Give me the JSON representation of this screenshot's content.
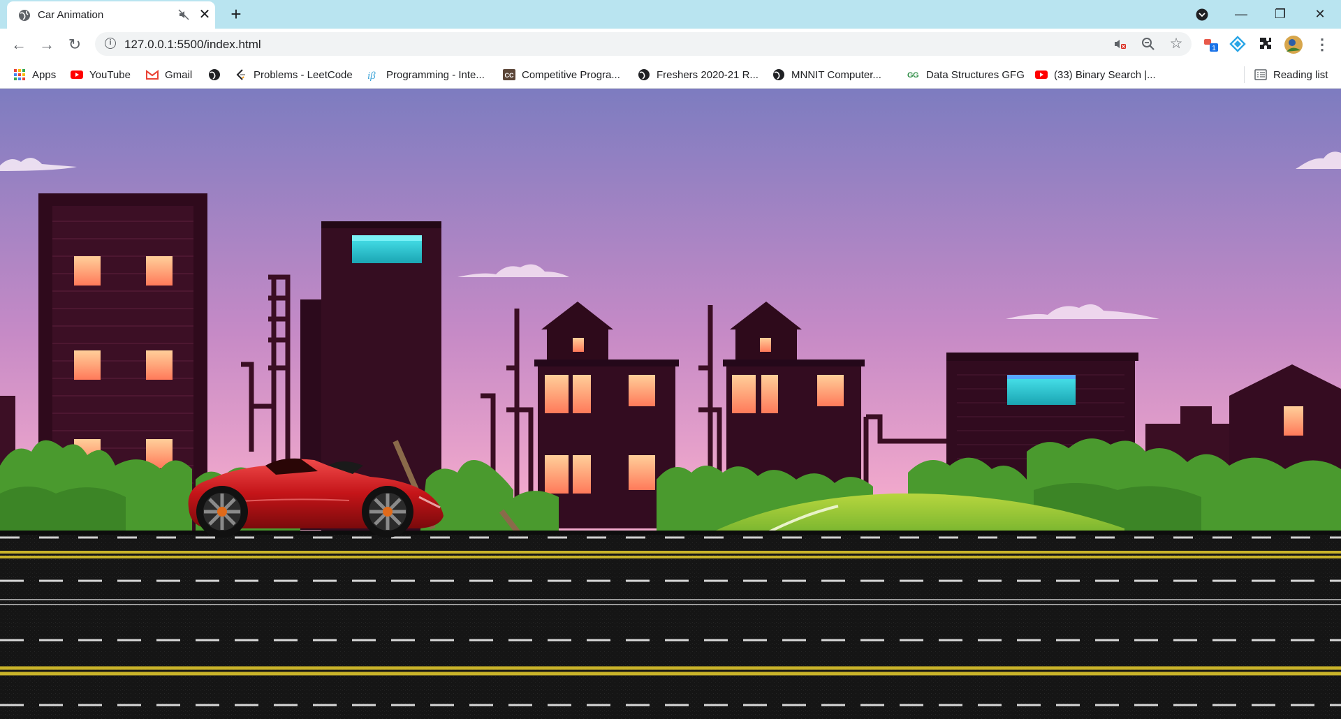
{
  "tab": {
    "title": "Car Animation"
  },
  "omnibox": {
    "url": "127.0.0.1:5500/index.html"
  },
  "bookmarks": [
    {
      "label": "Apps",
      "icon": "apps-grid-icon"
    },
    {
      "label": "YouTube",
      "icon": "youtube-icon"
    },
    {
      "label": "Gmail",
      "icon": "gmail-icon"
    },
    {
      "label": "",
      "icon": "globe-icon"
    },
    {
      "label": "Problems - LeetCode",
      "icon": "leetcode-icon"
    },
    {
      "label": "Programming - Inte...",
      "icon": "interviewbit-icon"
    },
    {
      "label": "Competitive Progra...",
      "icon": "codechef-icon"
    },
    {
      "label": "Freshers 2020-21 R...",
      "icon": "globe-icon"
    },
    {
      "label": "MNNIT Computer...",
      "icon": "globe-icon"
    },
    {
      "label": "Data Structures GFG",
      "icon": "gfg-icon"
    },
    {
      "label": "(33) Binary Search |...",
      "icon": "youtube-icon"
    }
  ],
  "reading_list": {
    "label": "Reading list"
  },
  "extensions": {
    "badge": "1"
  },
  "colors": {
    "tabbar": "#b9e4f0",
    "sky_top": "#7d7cc0",
    "sky_bottom": "#f2a9cc",
    "building_dark": "#3a0e23",
    "window_glow": "#ff9a6a",
    "cyan_window": "#3fd6e0",
    "bush_green": "#4a9a2e",
    "road": "#161616",
    "lane_yellow": "#c9b32a",
    "car_red": "#c41418"
  }
}
